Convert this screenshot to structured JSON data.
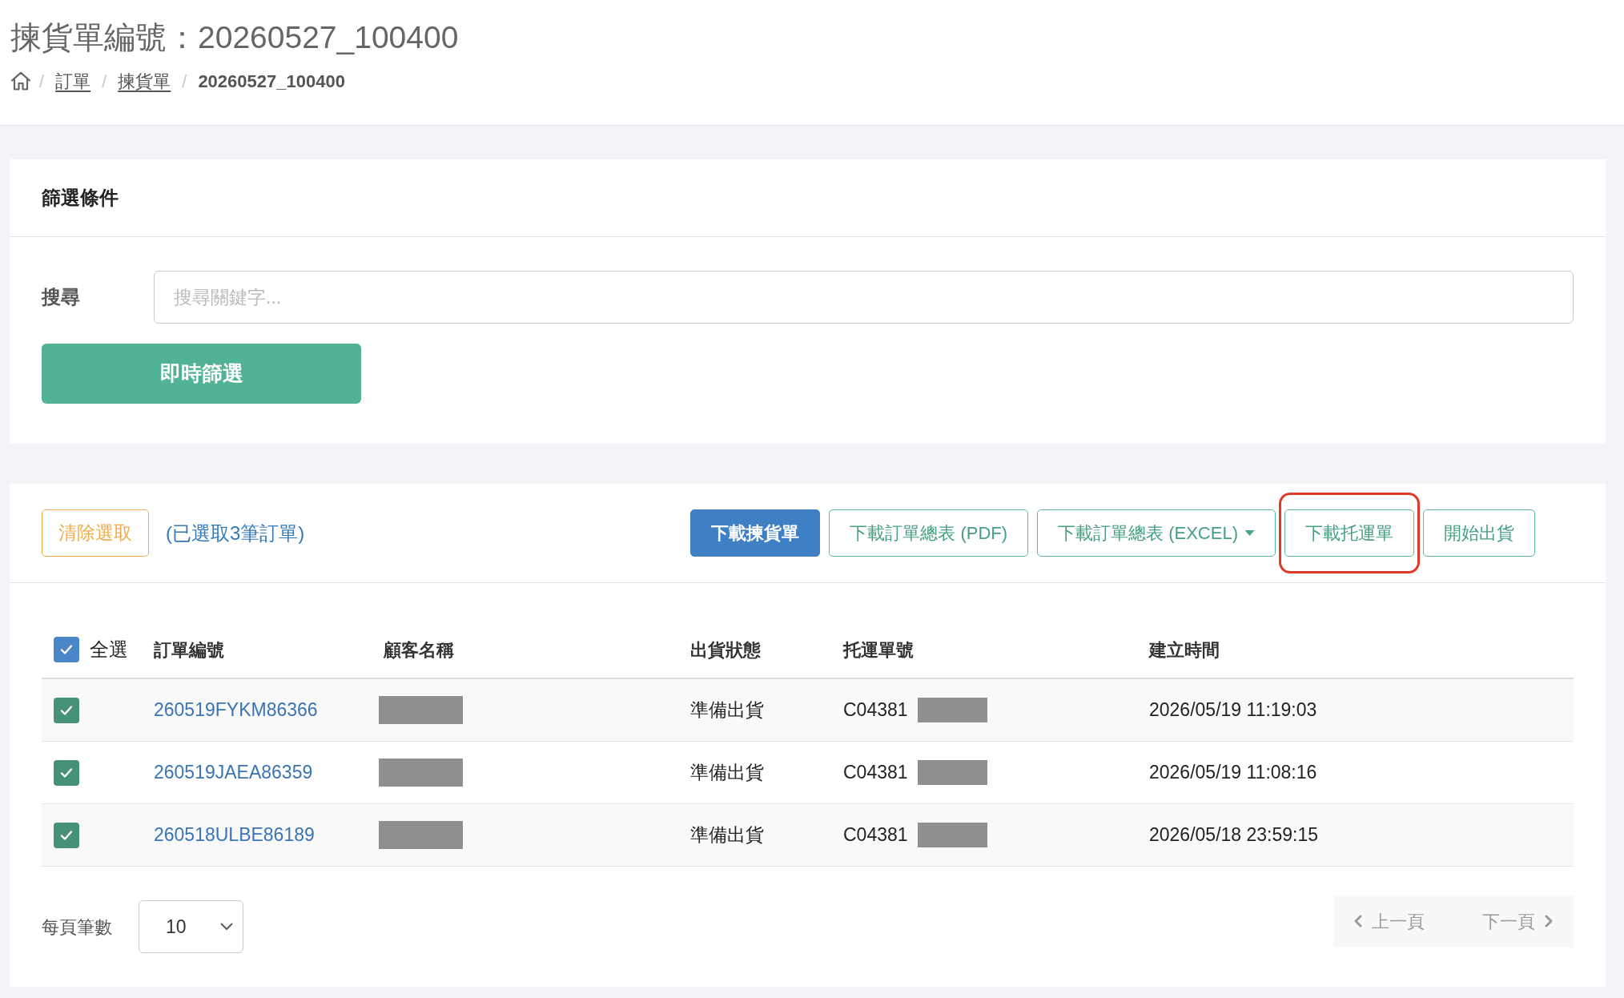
{
  "page_title": "揀貨單編號：20260527_100400",
  "breadcrumb": [
    {
      "kind": "home"
    },
    {
      "kind": "separator",
      "label": "/"
    },
    {
      "kind": "link",
      "label": "訂單"
    },
    {
      "kind": "separator",
      "label": "/"
    },
    {
      "kind": "link",
      "label": "揀貨單"
    },
    {
      "kind": "separator",
      "label": "/"
    },
    {
      "kind": "current",
      "label": "20260527_100400"
    }
  ],
  "filter": {
    "title": "篩選條件",
    "search": {
      "label": "搜尋",
      "placeholder": "搜尋關鍵字..."
    },
    "apply_button": "即時篩選"
  },
  "selection": {
    "clear_button": "清除選取",
    "summary": "(已選取3筆訂單)"
  },
  "actions": [
    {
      "label": "下載揀貨單",
      "kind": "primary",
      "highlighted": false
    },
    {
      "label": "下載訂單總表 (PDF)",
      "kind": "outline",
      "highlighted": false
    },
    {
      "label": "下載訂單總表 (EXCEL)",
      "kind": "dropdown",
      "highlighted": false
    },
    {
      "label": "下載托運單",
      "kind": "outline",
      "highlighted": true
    },
    {
      "label": "開始出貨",
      "kind": "outline",
      "highlighted": false
    }
  ],
  "table": {
    "select_all": {
      "label": "全選",
      "checked": true
    },
    "columns": [
      "訂單編號",
      "顧客名稱",
      "出貨狀態",
      "托運單號",
      "建立時間"
    ],
    "rows": [
      {
        "checked": true,
        "order_no": "260519FYKM86366",
        "status": "準備出貨",
        "tracking_no": "C04381",
        "created": "2026/05/19 11:19:03"
      },
      {
        "checked": true,
        "order_no": "260519JAEA86359",
        "status": "準備出貨",
        "tracking_no": "C04381",
        "created": "2026/05/19 11:08:16"
      },
      {
        "checked": true,
        "order_no": "260518ULBE86189",
        "status": "準備出貨",
        "tracking_no": "C04381",
        "created": "2026/05/18 23:59:15"
      }
    ]
  },
  "pagination": {
    "page_size_label": "每頁筆數",
    "page_size": "10",
    "prev": {
      "label": "上一頁",
      "disabled": true
    },
    "next": {
      "label": "下一頁",
      "disabled": true
    }
  }
}
